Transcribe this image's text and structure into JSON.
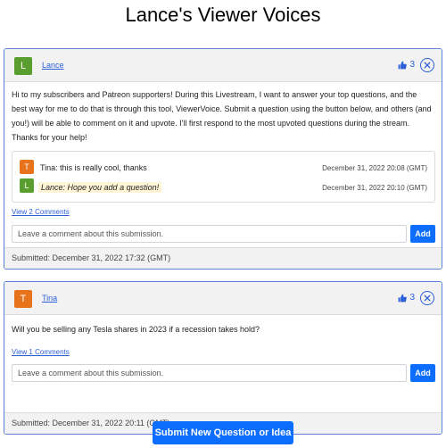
{
  "page": {
    "title": "Lance's Viewer Voices"
  },
  "colors": {
    "accent": "#0d6efd",
    "link": "#2b5fd9",
    "card_border": "#5b82d6",
    "avatar_lance": "#5a9e2f",
    "avatar_tina": "#e8731d",
    "highlight": "#fff5d6"
  },
  "submissions": [
    {
      "author": "Lance",
      "avatar_letter": "L",
      "votes": "3",
      "text": "Hi to my subscribers and Patreon supporters! During this Livestream, I want to answer your top questions, and the best way for me to do that is through this tool, ViewerVoice. Submit a question using the button below, and others (and you!) will be able to comment on it and upvote. I'll first respond to the most upvoted questions during the stream. Thanks for your help!",
      "comments": [
        {
          "avatar_letter": "T",
          "text": "Tina: this is really cool, thanks",
          "date": "December 31, 2022 20:08 (GMT)"
        },
        {
          "avatar_letter": "L",
          "text": "Lance: Hope you add a question!",
          "date": "December 31, 2022 20:10 (GMT)"
        }
      ],
      "view_comments": "View 2 Comments",
      "comment_placeholder": "Leave a comment about this submission.",
      "add_label": "Add",
      "submitted": "Submitted: December 31, 2022 17:32 (GMT)"
    },
    {
      "author": "Tina",
      "avatar_letter": "T",
      "votes": "3",
      "text": "Will you be selling any Tesla shares in 2023 if a recession takes hold?",
      "view_comments": "View 1 Comments",
      "comment_placeholder": "Leave a comment about this submission.",
      "add_label": "Add",
      "submitted": "Submitted: December 31, 2022 20:11 (GMT)"
    }
  ],
  "submit_button": "Submit New Question or Idea",
  "icons": {
    "upvote": "thumbs-up-icon",
    "remove": "close-circle-icon"
  }
}
